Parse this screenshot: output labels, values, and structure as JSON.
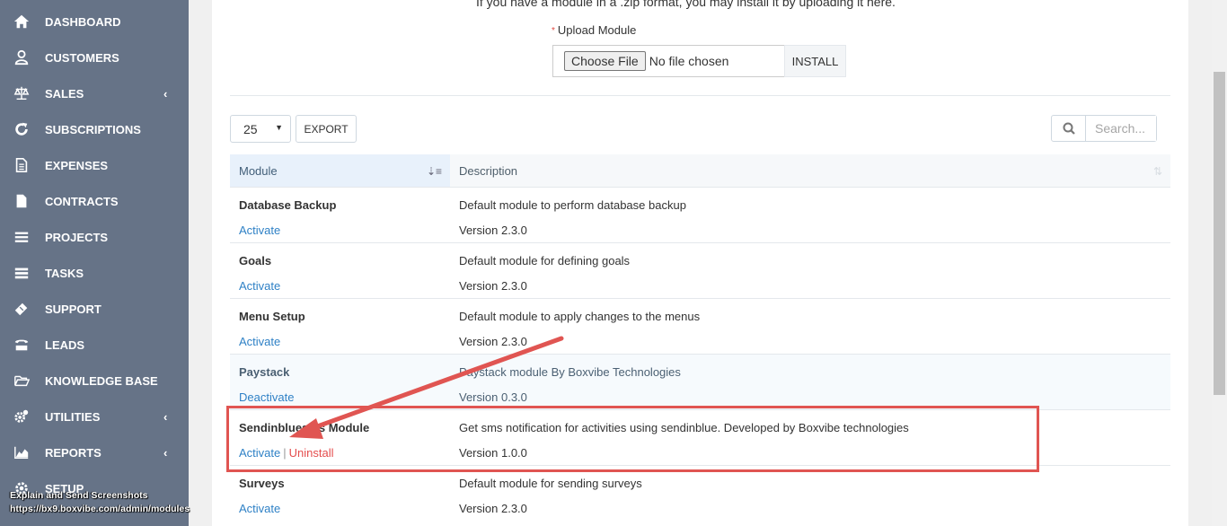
{
  "sidebar": {
    "items": [
      {
        "label": "DASHBOARD",
        "icon": "home-icon"
      },
      {
        "label": "CUSTOMERS",
        "icon": "user-icon"
      },
      {
        "label": "SALES",
        "icon": "balance-scale-icon",
        "chevron": "‹"
      },
      {
        "label": "SUBSCRIPTIONS",
        "icon": "refresh-icon"
      },
      {
        "label": "EXPENSES",
        "icon": "file-text-icon"
      },
      {
        "label": "CONTRACTS",
        "icon": "file-icon"
      },
      {
        "label": "PROJECTS",
        "icon": "bars-icon"
      },
      {
        "label": "TASKS",
        "icon": "tasks-icon"
      },
      {
        "label": "SUPPORT",
        "icon": "ticket-icon"
      },
      {
        "label": "LEADS",
        "icon": "tty-icon"
      },
      {
        "label": "KNOWLEDGE BASE",
        "icon": "folder-open-icon"
      },
      {
        "label": "UTILITIES",
        "icon": "cogs-icon",
        "chevron": "‹"
      },
      {
        "label": "REPORTS",
        "icon": "area-chart-icon",
        "chevron": "‹"
      },
      {
        "label": "SETUP",
        "icon": "cog-icon"
      }
    ]
  },
  "overlay": {
    "line1": "Explain and Send Screenshots",
    "line2": "https://bx9.boxvibe.com/admin/modules"
  },
  "upload": {
    "hint": "If you have a module in a .zip format, you may install it by uploading it here.",
    "required_mark": "*",
    "label": "Upload Module",
    "choose_file": "Choose File",
    "no_file": "No file chosen",
    "install": "INSTALL"
  },
  "toolbar": {
    "page_length": "25",
    "export": "EXPORT",
    "search_placeholder": "Search..."
  },
  "table": {
    "headers": {
      "module": "Module",
      "description": "Description"
    },
    "rows": [
      {
        "name": "Database Backup",
        "action1": "Activate",
        "description": "Default module to perform database backup",
        "version": "Version 2.3.0"
      },
      {
        "name": "Goals",
        "action1": "Activate",
        "description": "Default module for defining goals",
        "version": "Version 2.3.0"
      },
      {
        "name": "Menu Setup",
        "action1": "Activate",
        "description": "Default module to apply changes to the menus",
        "version": "Version 2.3.0"
      },
      {
        "name": "Paystack",
        "action1": "Deactivate",
        "description": "Paystack module By Boxvibe Technologies",
        "version": "Version 0.3.0"
      },
      {
        "name": "Sendinbluesms Module",
        "action1": "Activate",
        "separator": "|",
        "action2": "Uninstall",
        "description": "Get sms notification for activities using sendinblue. Developed by Boxvibe technologies",
        "version": "Version 1.0.0"
      },
      {
        "name": "Surveys",
        "action1": "Activate",
        "description": "Default module for sending surveys",
        "version": "Version 2.3.0"
      }
    ]
  },
  "colors": {
    "sidebar_bg": "#667387",
    "link": "#2f81c6",
    "danger": "#e44d4d",
    "annotation": "#e05552"
  }
}
